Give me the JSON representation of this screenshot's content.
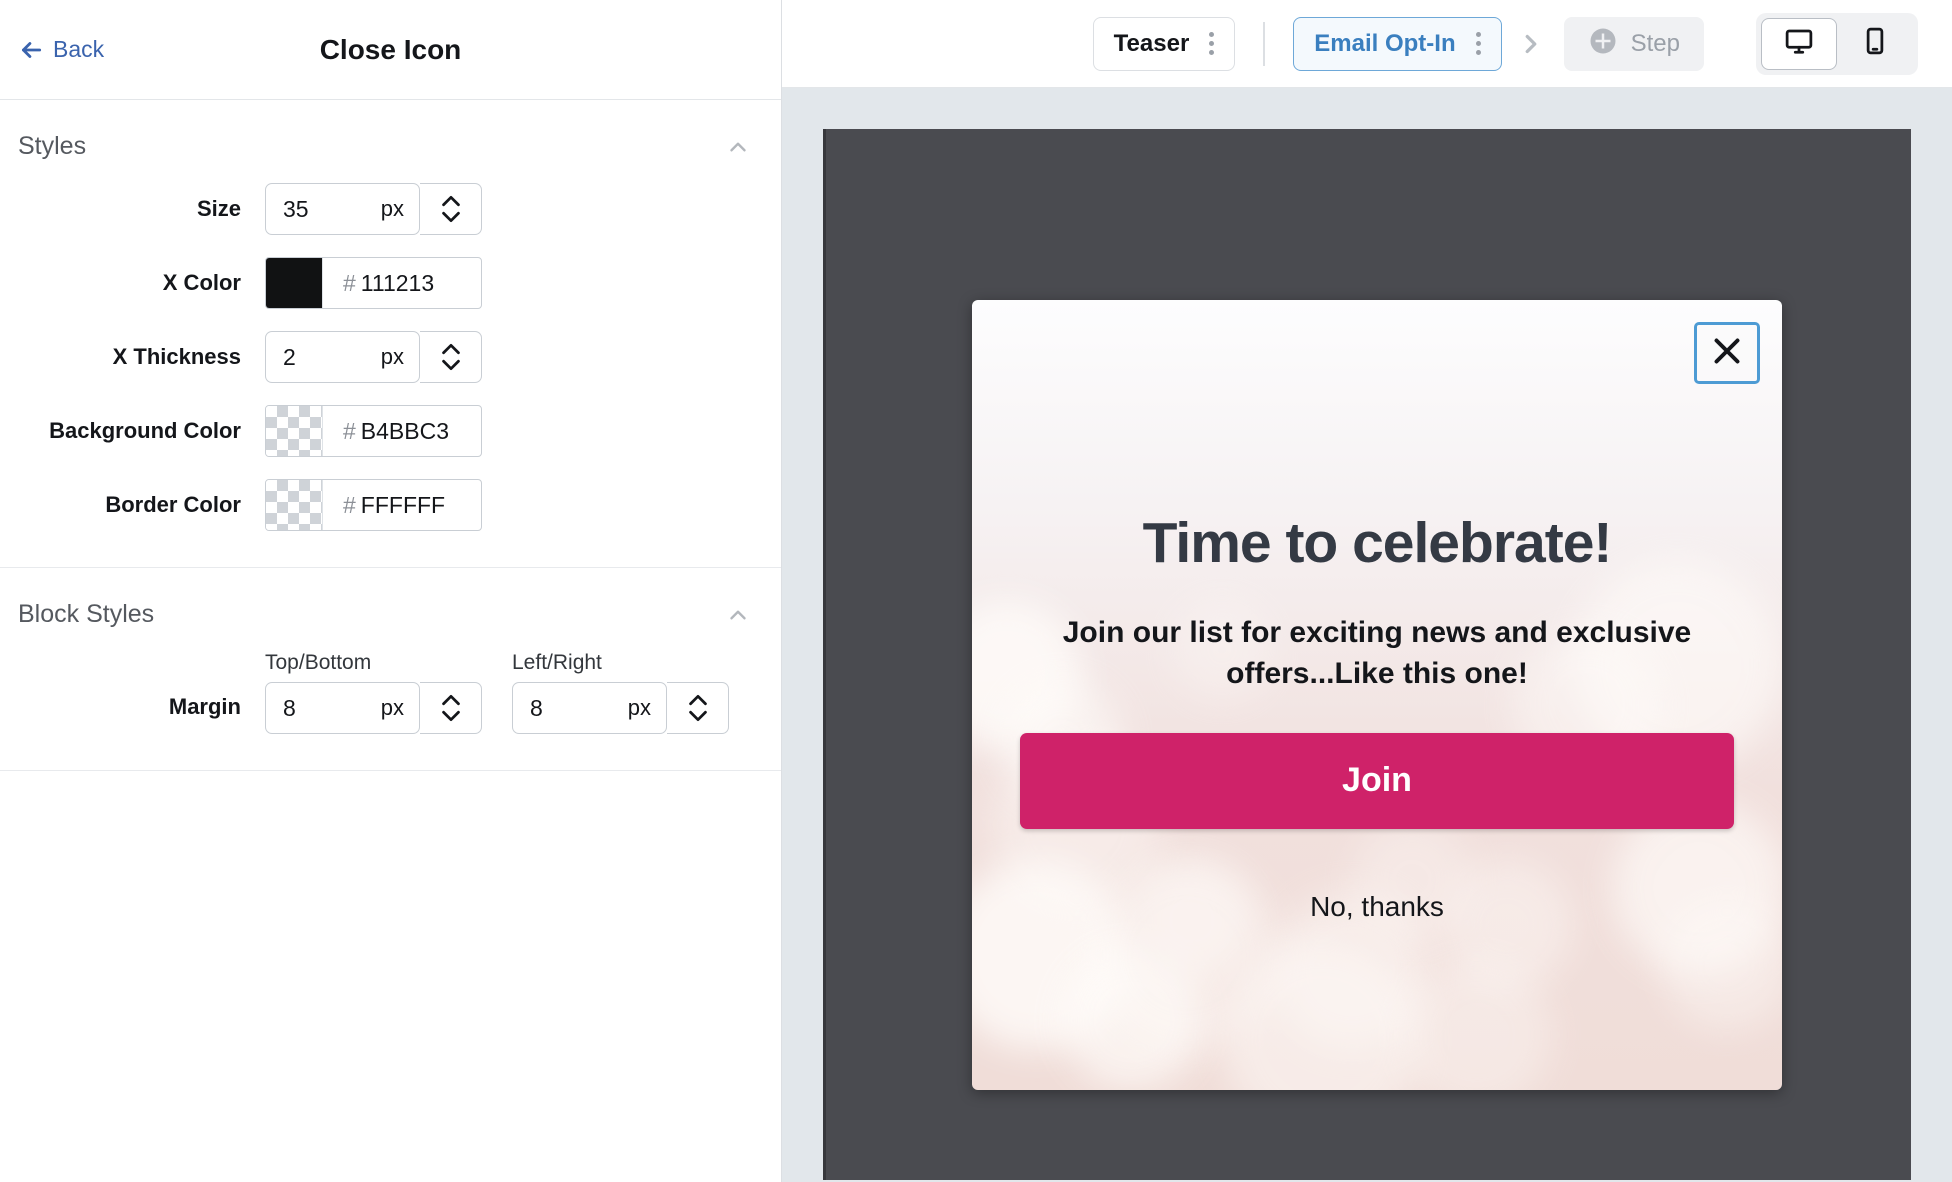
{
  "sidebar": {
    "back_label": "Back",
    "title": "Close Icon",
    "sections": [
      {
        "title": "Styles",
        "rows": [
          {
            "label": "Size",
            "kind": "number",
            "value": "35",
            "unit": "px"
          },
          {
            "label": "X Color",
            "kind": "color",
            "hex": "111213",
            "swatch": "#111213",
            "transparent": false
          },
          {
            "label": "X Thickness",
            "kind": "number",
            "value": "2",
            "unit": "px"
          },
          {
            "label": "Background Color",
            "kind": "color",
            "hex": "B4BBC3",
            "swatch": "transparent",
            "transparent": true
          },
          {
            "label": "Border Color",
            "kind": "color",
            "hex": "FFFFFF",
            "swatch": "transparent",
            "transparent": true
          }
        ]
      },
      {
        "title": "Block Styles",
        "margin": {
          "label": "Margin",
          "top_bottom_caption": "Top/Bottom",
          "top_bottom_value": "8",
          "top_bottom_unit": "px",
          "left_right_caption": "Left/Right",
          "left_right_value": "8",
          "left_right_unit": "px"
        }
      }
    ]
  },
  "toolbar": {
    "teaser_tab": "Teaser",
    "email_tab": "Email Opt-In",
    "step_label": "Step",
    "desktop_icon": "monitor-icon",
    "mobile_icon": "phone-icon"
  },
  "popup": {
    "headline": "Time to celebrate!",
    "subhead": "Join our list for exciting news and exclusive offers...Like this one!",
    "cta_label": "Join",
    "dismiss_label": "No, thanks",
    "cta_color": "#CF2269",
    "selection_color": "#4D9BD4"
  }
}
